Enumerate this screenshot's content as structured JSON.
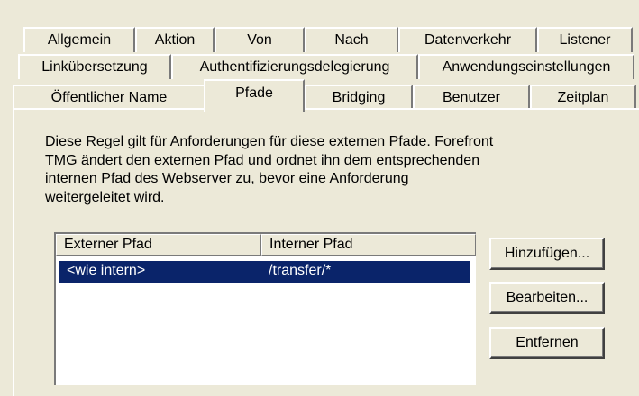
{
  "tabs": {
    "row1": [
      "Allgemein",
      "Aktion",
      "Von",
      "Nach",
      "Datenverkehr",
      "Listener"
    ],
    "row2": [
      "Linkübersetzung",
      "Authentifizierungsdelegierung",
      "Anwendungseinstellungen"
    ],
    "row3": [
      "Öffentlicher Name",
      "Pfade",
      "Bridging",
      "Benutzer",
      "Zeitplan"
    ],
    "active": "Pfade"
  },
  "description": "Diese Regel gilt für Anforderungen für diese externen Pfade. Forefront TMG ändert den externen Pfad und ordnet ihn dem entsprechenden internen Pfad des Webserver zu, bevor eine Anforderung weitergeleitet wird.",
  "description_lines": [
    "Diese Regel gilt für Anforderungen für diese externen Pfade. Forefront",
    "TMG ändert den externen Pfad und ordnet ihn dem entsprechenden",
    "internen Pfad des Webserver zu, bevor eine Anforderung",
    "weitergeleitet wird."
  ],
  "paths_table": {
    "columns": [
      "Externer Pfad",
      "Interner Pfad"
    ],
    "rows": [
      {
        "external": "<wie intern>",
        "internal": "/transfer/*",
        "selected": true
      }
    ]
  },
  "buttons": {
    "add": "Hinzufügen...",
    "edit": "Bearbeiten...",
    "remove": "Entfernen"
  },
  "colors": {
    "dialog_bg": "#ece9d8",
    "selection_bg": "#0a246a",
    "selection_text": "#ffffff"
  }
}
